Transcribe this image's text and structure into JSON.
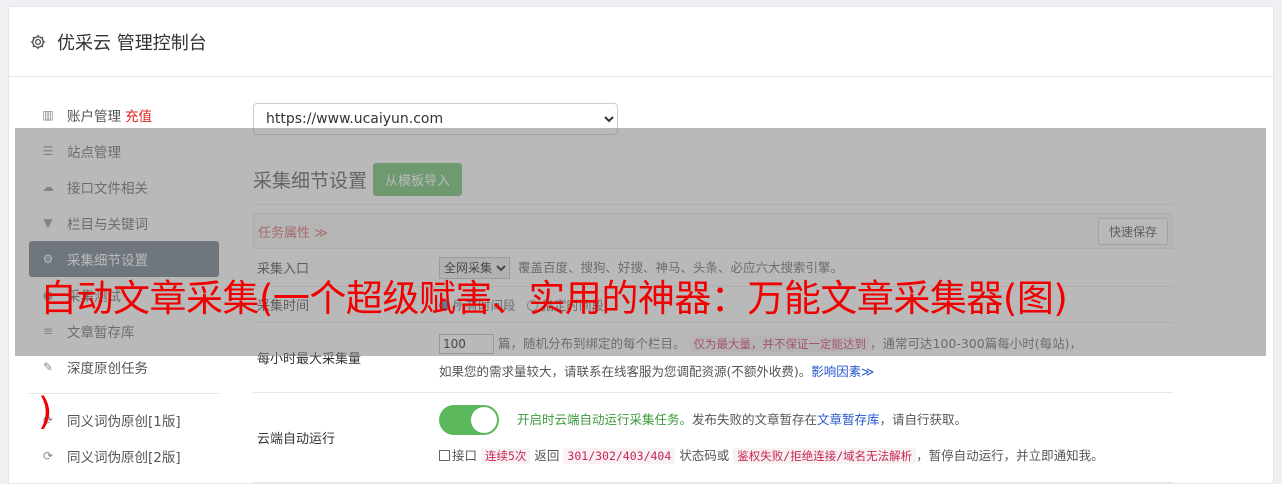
{
  "header": {
    "title": "优采云 管理控制台",
    "icon": "gear-icon"
  },
  "sidebar": {
    "items": [
      {
        "label": "账户管理",
        "badge": "充值",
        "icon": "bar-chart-icon"
      },
      {
        "label": "站点管理",
        "icon": "server-icon"
      },
      {
        "label": "接口文件相关",
        "icon": "cloud-upload-icon"
      },
      {
        "label": "栏目与关键词",
        "icon": "filter-icon"
      },
      {
        "label": "采集细节设置",
        "icon": "cogs-icon",
        "active": true
      },
      {
        "label": "采集测试",
        "icon": "circle-icon"
      },
      {
        "label": "文章暂存库",
        "icon": "database-icon"
      },
      {
        "label": "深度原创任务",
        "icon": "edit-icon"
      },
      {
        "label": "同义词伪原创[1版]",
        "icon": "refresh-icon"
      },
      {
        "label": "同义词伪原创[2版]",
        "icon": "refresh-icon"
      }
    ]
  },
  "main": {
    "site_select": "https://www.ucaiyun.com",
    "section_title": "采集细节设置",
    "import_button": "从模板导入",
    "task_label": "任务属性 ≫",
    "save_button": "快速保存",
    "rows": {
      "entry": {
        "label": "采集入口",
        "select": "全网采集",
        "desc": "覆盖百度、搜狗、好搜、神马、头条、必应六大搜索引擎。"
      },
      "time": {
        "label": "采集时间",
        "opt1": "所有时间段",
        "opt2": "指定时间段"
      },
      "max": {
        "label": "每小时最大采集量",
        "value": "100",
        "line1a": "篇，随机分布到绑定的每个栏目。",
        "line1code": "仅为最大量，并不保证一定能达到",
        "line1b": "，通常可达100-300篇每小时(每站)，",
        "line2a": "如果您的需求量较大，请联系在线客服为您调配资源(不额外收费)。",
        "line2link": "影响因素≫"
      },
      "auto": {
        "label": "云端自动运行",
        "toggle_on": true,
        "text_green": "开启时云端自动运行采集任务。",
        "text_a": "发布失败的文章暂存在",
        "text_link": "文章暂存库",
        "text_b": "，请自行获取。",
        "chk_a": "接口",
        "chk_code1": "连续5次",
        "chk_b": "返回",
        "chk_code2": "301/302/403/404",
        "chk_c": "状态码或",
        "chk_code3": "鉴权失败/拒绝连接/域名无法解析",
        "chk_d": "，暂停自动运行，并立即通知我。"
      }
    }
  },
  "overlay": {
    "headline": "自动文章采集(一个超级赋害、实用的神器：万能文章采集器(图)",
    "headline_tail": ")"
  },
  "colors": {
    "headline": "#f00000",
    "active_nav": "#5b6b7c",
    "import_button": "#5cb85c",
    "recharge": "#e02020"
  }
}
